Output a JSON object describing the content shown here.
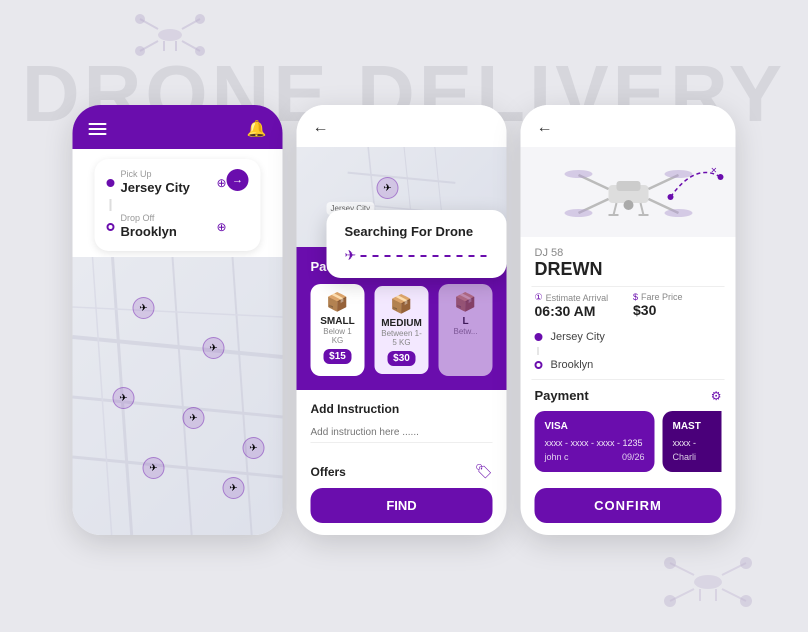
{
  "background": {
    "title": "DRONE DELIVERY"
  },
  "phone1": {
    "pickup_label": "Pick Up",
    "pickup_city": "Jersey City",
    "dropoff_label": "Drop Off",
    "dropoff_city": "Brooklyn"
  },
  "phone2": {
    "search_drone_title": "Searching For Drone",
    "packages_title": "Packages Size",
    "package_small": "SMALL",
    "package_small_sub": "Below 1 KG",
    "package_small_price": "$15",
    "package_medium": "MEDIUM",
    "package_medium_sub": "Between 1-5 KG",
    "package_medium_price": "$30",
    "package_large": "L",
    "package_large_sub": "Betw...",
    "instruction_title": "Add Instruction",
    "instruction_placeholder": "Add instruction here ......",
    "offers_label": "Offers",
    "find_btn": "FIND"
  },
  "phone3": {
    "drone_model": "DJ 58",
    "drone_name": "DREWN",
    "estimate_label": "Estimate Arrival",
    "estimate_value": "06:30 AM",
    "fare_label": "Fare Price",
    "fare_value": "$30",
    "city_from": "Jersey City",
    "city_to": "Brooklyn",
    "payment_title": "Payment",
    "visa_type": "VISA",
    "visa_number": "xxxx - xxxx - xxxx - 1235",
    "visa_holder": "john c",
    "visa_expiry": "09/26",
    "master_type": "MAST",
    "master_number": "xxxx -",
    "master_holder": "Charli",
    "confirm_btn": "CONFIRM"
  }
}
